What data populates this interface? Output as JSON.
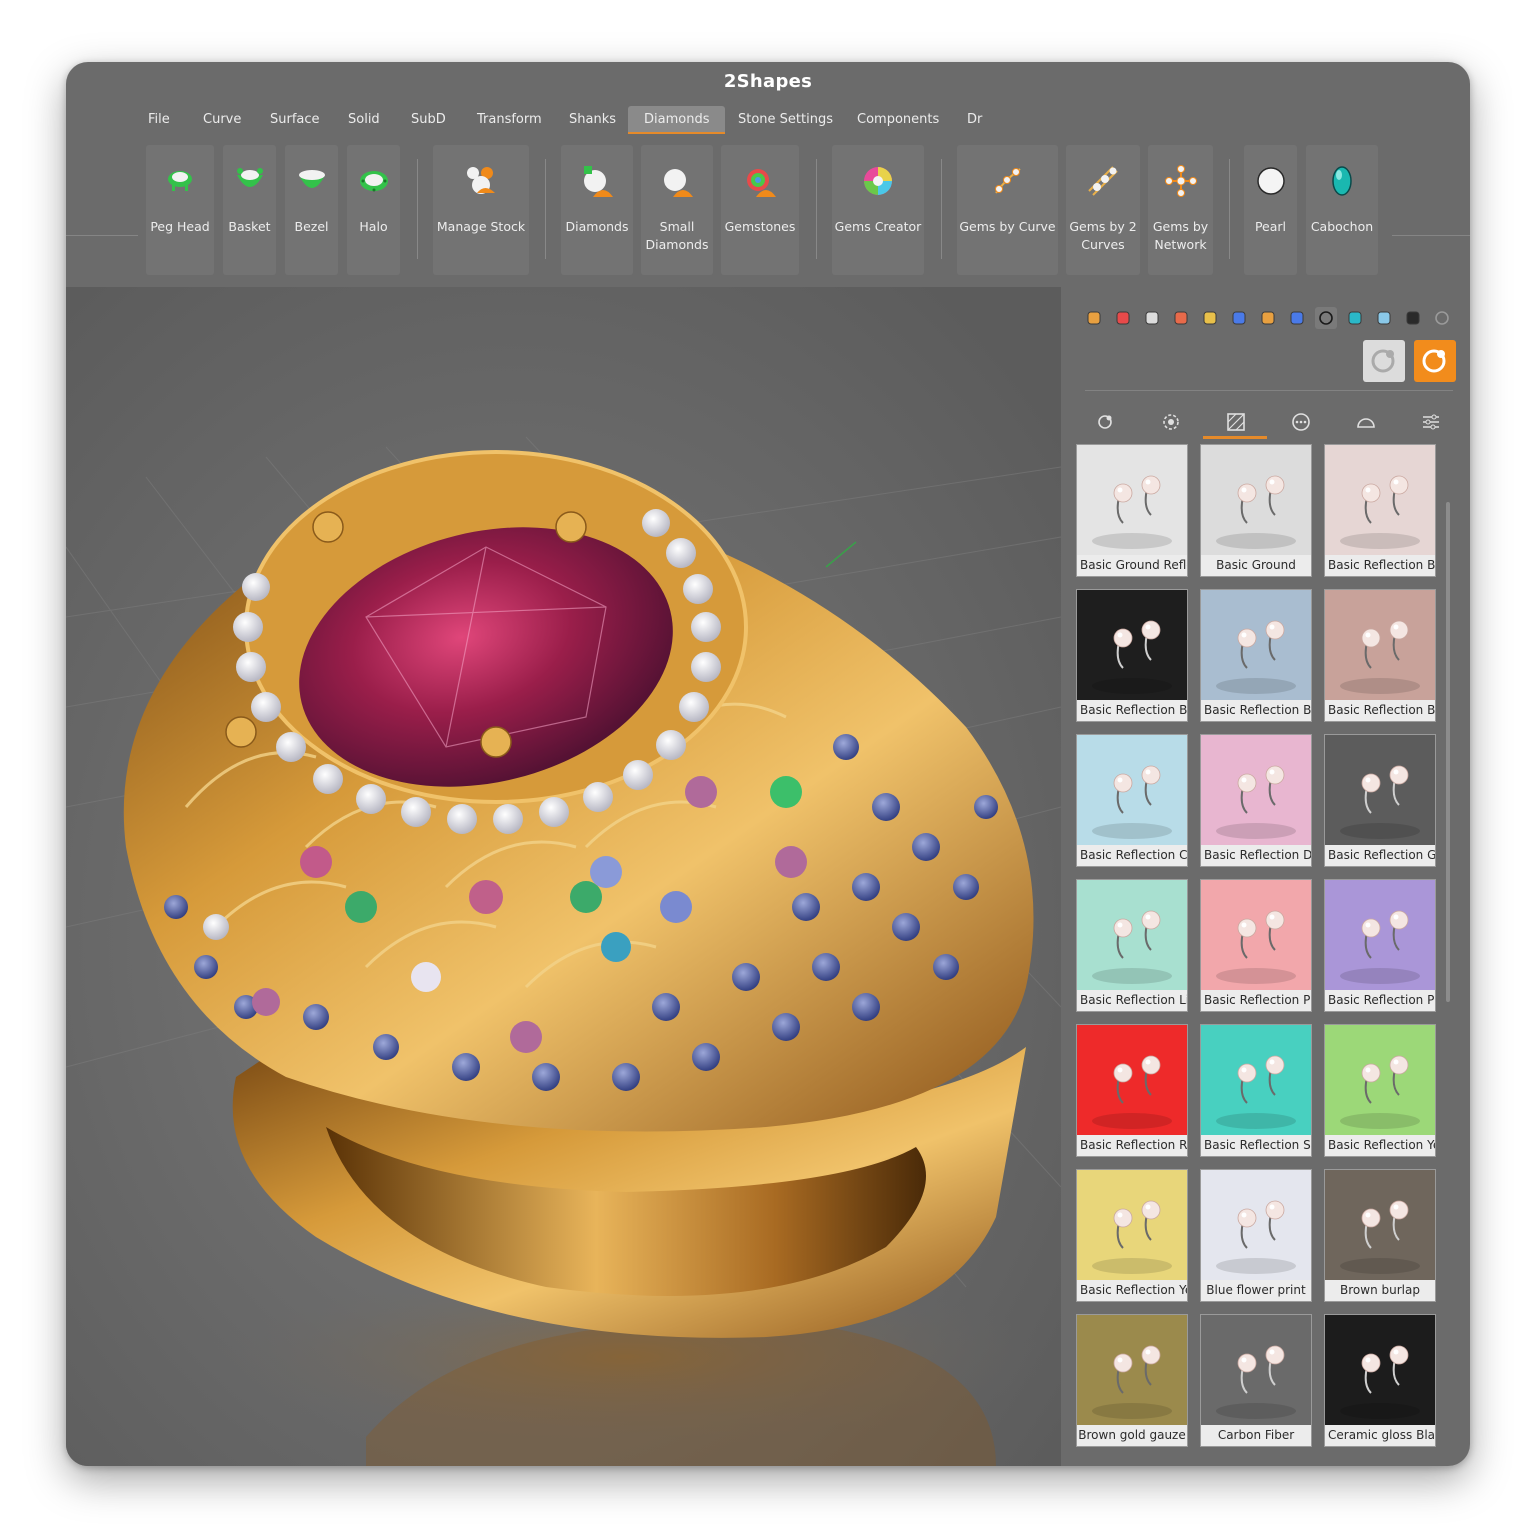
{
  "window": {
    "title": "2Shapes"
  },
  "menu": {
    "items": [
      "File",
      "Curve",
      "Surface",
      "Solid",
      "SubD",
      "Transform",
      "Shanks",
      "Diamonds",
      "Stone Settings",
      "Components",
      "Dr"
    ],
    "active": "Diamonds",
    "accent": "#e58a2a"
  },
  "ribbon": {
    "tools": [
      {
        "label": "Peg Head",
        "icon": "peg-head-icon"
      },
      {
        "label": "Basket",
        "icon": "basket-icon"
      },
      {
        "label": "Bezel",
        "icon": "bezel-icon"
      },
      {
        "label": "Halo",
        "icon": "halo-icon"
      },
      {
        "label": "Manage Stock",
        "icon": "manage-stock-icon"
      },
      {
        "label": "Diamonds",
        "icon": "diamonds-icon"
      },
      {
        "label": "Small Diamonds",
        "icon": "small-diamonds-icon"
      },
      {
        "label": "Gemstones",
        "icon": "gemstones-icon"
      },
      {
        "label": "Gems Creator",
        "icon": "gems-creator-icon"
      },
      {
        "label": "Gems by Curve",
        "icon": "gems-by-curve-icon"
      },
      {
        "label": "Gems by 2 Curves",
        "icon": "gems-by-2-curves-icon"
      },
      {
        "label": "Gems by Network",
        "icon": "gems-by-network-icon"
      },
      {
        "label": "Pearl",
        "icon": "pearl-icon"
      },
      {
        "label": "Cabochon",
        "icon": "cabochon-icon"
      }
    ]
  },
  "panel": {
    "toolbar_icons": [
      "pencil-icon",
      "layers-icon",
      "render-icon",
      "brush-icon",
      "folder-icon",
      "help-icon",
      "hierarchy-icon",
      "material-ball-icon",
      "circle-icon",
      "environment-icon",
      "camera-settings-icon",
      "camera-icon",
      "settings-icon"
    ],
    "active_toolbar_icon": "circle-icon",
    "tabs": [
      "environment-tab-icon",
      "lighting-tab-icon",
      "backdrop-tab-icon",
      "more-tab-icon",
      "dome-tab-icon",
      "adjust-tab-icon"
    ],
    "active_tab": "backdrop-tab-icon",
    "environments": [
      {
        "label": "Basic Ground Refle",
        "bg": "#e4e4e4"
      },
      {
        "label": "Basic Ground",
        "bg": "#dcdcdc"
      },
      {
        "label": "Basic Reflection Be",
        "bg": "#e6d6d4"
      },
      {
        "label": "Basic Reflection Bla",
        "bg": "#1e1e1e"
      },
      {
        "label": "Basic Reflection Blu",
        "bg": "#a9bdd0"
      },
      {
        "label": "Basic Reflection Br",
        "bg": "#c8a29a"
      },
      {
        "label": "Basic Reflection Cy",
        "bg": "#b8dce8"
      },
      {
        "label": "Basic Reflection Da",
        "bg": "#e8b6d0"
      },
      {
        "label": "Basic Reflection Gr",
        "bg": "#5c5c5c"
      },
      {
        "label": "Basic Reflection Lig",
        "bg": "#a8e0d0"
      },
      {
        "label": "Basic Reflection Pi",
        "bg": "#f2a7ab"
      },
      {
        "label": "Basic Reflection Pu",
        "bg": "#aa96d8"
      },
      {
        "label": "Basic Reflection Re",
        "bg": "#ee2a2a"
      },
      {
        "label": "Basic Reflection Sc",
        "bg": "#48d0c0"
      },
      {
        "label": "Basic Reflection Ye",
        "bg": "#9cd878"
      },
      {
        "label": "Basic Reflection Ye",
        "bg": "#e8d67a"
      },
      {
        "label": "Blue flower print",
        "bg": "#e4e6ee"
      },
      {
        "label": "Brown burlap",
        "bg": "#6f665c"
      },
      {
        "label": "Brown gold gauze",
        "bg": "#9b8a4c"
      },
      {
        "label": "Carbon Fiber",
        "bg": "#6a6a6a"
      },
      {
        "label": "Ceramic gloss Blac",
        "bg": "#1c1c1c"
      }
    ]
  }
}
